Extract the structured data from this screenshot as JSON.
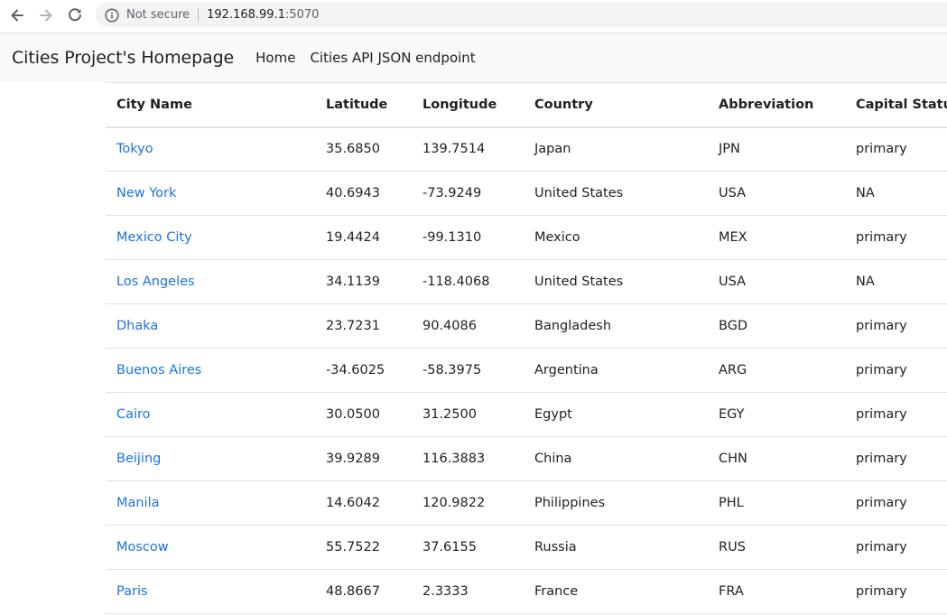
{
  "browser": {
    "security_label": "Not secure",
    "url_host": "192.168.99.1",
    "url_port": ":5070",
    "icons": {
      "back": "arrow-left-icon",
      "forward": "arrow-right-icon",
      "reload": "reload-icon",
      "info": "info-circle-icon"
    }
  },
  "navbar": {
    "brand": "Cities Project's Homepage",
    "links": [
      {
        "label": "Home"
      },
      {
        "label": "Cities API JSON endpoint"
      }
    ]
  },
  "colors": {
    "link": "#1a73e8",
    "navbar_bg": "#f8f9fa",
    "border": "#dee2e6"
  },
  "table": {
    "headers": [
      "City Name",
      "Latitude",
      "Longitude",
      "Country",
      "Abbreviation",
      "Capital Status"
    ],
    "rows": [
      [
        "Tokyo",
        "35.6850",
        "139.7514",
        "Japan",
        "JPN",
        "primary"
      ],
      [
        "New York",
        "40.6943",
        "-73.9249",
        "United States",
        "USA",
        "NA"
      ],
      [
        "Mexico City",
        "19.4424",
        "-99.1310",
        "Mexico",
        "MEX",
        "primary"
      ],
      [
        "Los Angeles",
        "34.1139",
        "-118.4068",
        "United States",
        "USA",
        "NA"
      ],
      [
        "Dhaka",
        "23.7231",
        "90.4086",
        "Bangladesh",
        "BGD",
        "primary"
      ],
      [
        "Buenos Aires",
        "-34.6025",
        "-58.3975",
        "Argentina",
        "ARG",
        "primary"
      ],
      [
        "Cairo",
        "30.0500",
        "31.2500",
        "Egypt",
        "EGY",
        "primary"
      ],
      [
        "Beijing",
        "39.9289",
        "116.3883",
        "China",
        "CHN",
        "primary"
      ],
      [
        "Manila",
        "14.6042",
        "120.9822",
        "Philippines",
        "PHL",
        "primary"
      ],
      [
        "Moscow",
        "55.7522",
        "37.6155",
        "Russia",
        "RUS",
        "primary"
      ],
      [
        "Paris",
        "48.8667",
        "2.3333",
        "France",
        "FRA",
        "primary"
      ]
    ]
  }
}
